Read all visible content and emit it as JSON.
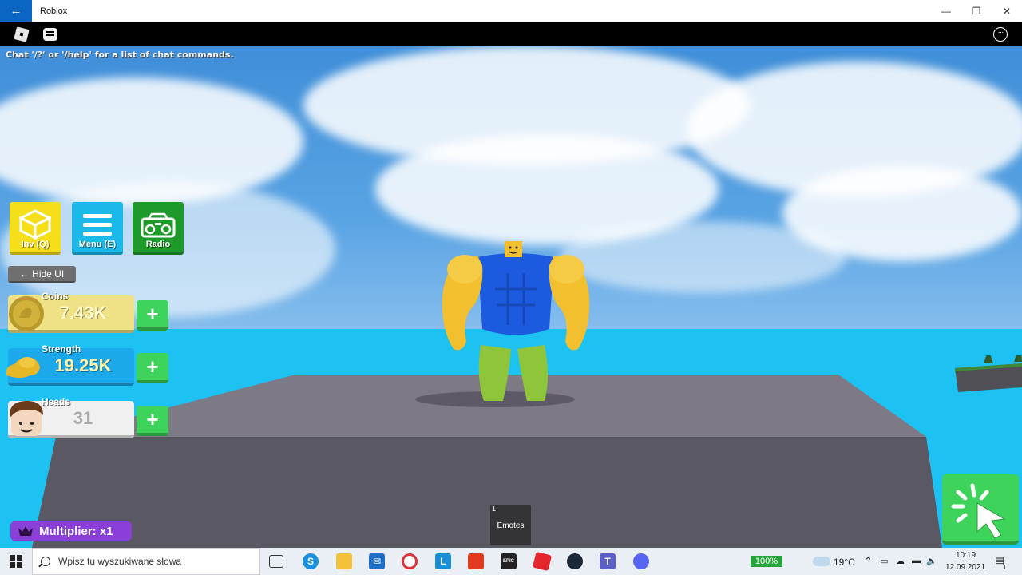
{
  "window": {
    "title": "Roblox",
    "back_glyph": "←",
    "minimize": "—",
    "restore": "❐",
    "close": "✕"
  },
  "roblox_topbar": {
    "more_glyph": "···"
  },
  "chat": {
    "hint": "Chat '/?' or '/help' for a list of chat commands."
  },
  "hud": {
    "buttons": [
      {
        "label": "Inv (Q)",
        "icon": "box-icon",
        "color": "#f5de1a"
      },
      {
        "label": "Menu (E)",
        "icon": "hamburger-icon",
        "color": "#1bb8ea"
      },
      {
        "label": "Radio",
        "icon": "radio-icon",
        "color": "#1e9a2a"
      }
    ],
    "hide_ui": "← Hide UI",
    "stats": [
      {
        "name": "Coins",
        "value": "7.43K",
        "icon": "coin-icon"
      },
      {
        "name": "Strength",
        "value": "19.25K",
        "icon": "flexed-arm-icon"
      },
      {
        "name": "Heads",
        "value": "31",
        "icon": "noob-head-icon"
      }
    ],
    "plus_glyph": "+",
    "multiplier": "Multiplier: x1"
  },
  "hotbar": {
    "slot_number": "1",
    "slot_label": "Emotes"
  },
  "taskbar": {
    "search_placeholder": "Wpisz tu wyszukiwane słowa",
    "battery": "100%",
    "temperature": "19°C",
    "time": "10:19",
    "date": "12.09.2021",
    "notification_count": "1"
  },
  "colors": {
    "sky": "#5aa4e4",
    "ocean": "#1ec2f2",
    "plus_green": "#3ed35b",
    "multiplier_purple": "#8a3fd9",
    "accent_blue": "#0a66c2"
  }
}
